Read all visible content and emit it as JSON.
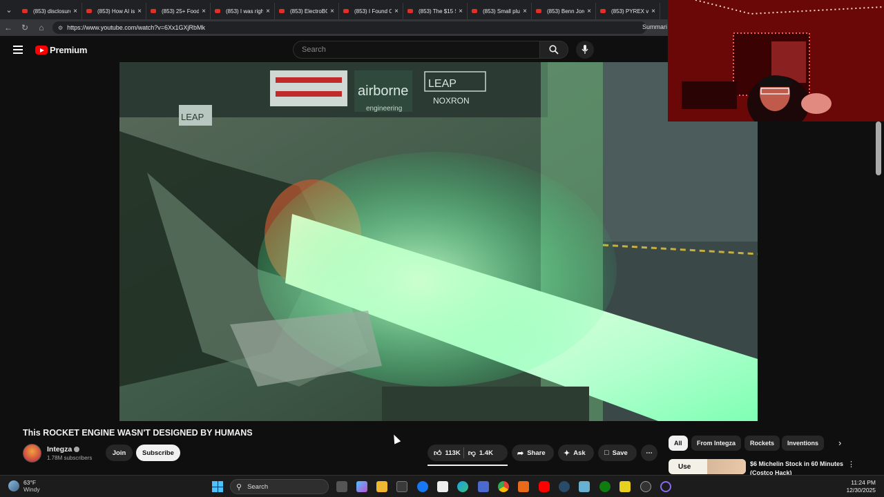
{
  "browser": {
    "tabs": [
      {
        "title": "(853) disclosure"
      },
      {
        "title": "(853) How AI is"
      },
      {
        "title": "(853) 25+ Food"
      },
      {
        "title": "(853) I was righ"
      },
      {
        "title": "(853) ElectroBO"
      },
      {
        "title": "(853) I Found O"
      },
      {
        "title": "(853) The $15 S"
      },
      {
        "title": "(853) Small plu"
      },
      {
        "title": "(853) Benn Jord"
      },
      {
        "title": "(853) PYREX vs"
      }
    ],
    "url": "https://www.youtube.com/watch?v=6Xx1GXjRbMk",
    "summarize_label": "Summari"
  },
  "youtube": {
    "brand": "Premium",
    "search_placeholder": "Search",
    "video_overlay": {
      "sign_leap": "LEAP",
      "sign_airborne": "airborne",
      "sign_engineering": "engineering",
      "sign_leap2": "LEAP",
      "sign_noxron": "NOXRON"
    },
    "video_title": "This ROCKET ENGINE WASN'T DESIGNED BY HUMANS",
    "channel": {
      "name": "Integza",
      "subscribers": "1.78M subscribers"
    },
    "join_label": "Join",
    "subscribe_label": "Subscribe",
    "likes": "113K",
    "dislikes": "1.4K",
    "share_label": "Share",
    "ask_label": "Ask",
    "save_label": "Save",
    "chips": [
      "All",
      "From Integza",
      "Rockets",
      "Inventions"
    ],
    "related": {
      "thumb_text": "Use",
      "title": "$6 Michelin Stock in 60 Minutes (Costco Hack)"
    }
  },
  "taskbar": {
    "temp": "63°F",
    "condition": "Windy",
    "search_label": "Search",
    "time": "11:24 PM",
    "date": "12/30/2025"
  },
  "colors": {
    "brand_red": "#ff0000",
    "page_bg": "#0f0f0f",
    "chip_bg": "#272727"
  }
}
